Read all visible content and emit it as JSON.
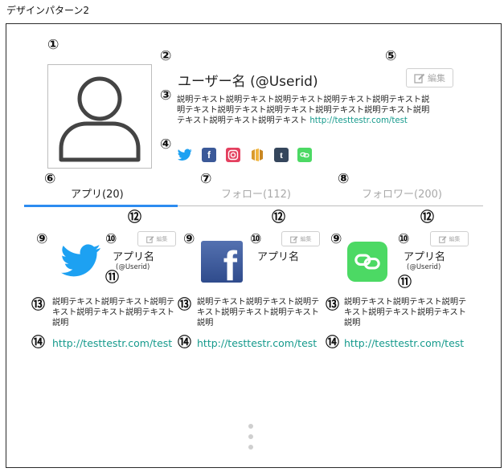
{
  "page_title": "デザインパターン2",
  "markers": [
    "①",
    "②",
    "③",
    "④",
    "⑤",
    "⑥",
    "⑦",
    "⑧",
    "⑨",
    "⑩",
    "⑪",
    "⑫",
    "⑬",
    "⑭"
  ],
  "profile": {
    "username": "ユーザー名 (@Userid)",
    "edit_label": "編集",
    "description": "説明テキスト説明テキスト説明テキスト説明テキスト説明テキスト説明テキスト説明テキスト説明テキスト説明テキスト説明テキスト説明テキスト説明テキスト説明テキスト ",
    "link": "http://testtestr.com/test",
    "social_icons": [
      "twitter-icon",
      "facebook-icon",
      "instagram-icon",
      "aws-icon",
      "tumblr-icon",
      "line-icon"
    ]
  },
  "tabs": [
    {
      "label": "アプリ(20)",
      "active": true
    },
    {
      "label": "フォロー(112)",
      "active": false
    },
    {
      "label": "フォロワー(200)",
      "active": false
    }
  ],
  "apps": [
    {
      "icon": "twitter-icon",
      "name": "アプリ名",
      "userid": "(@Userid)",
      "edit_label": "編集",
      "description": "説明テキスト説明テキスト説明テキスト説明テキスト説明テキスト説明",
      "link": "http://testtestr.com/test"
    },
    {
      "icon": "facebook-icon",
      "name": "アプリ名",
      "userid": "",
      "edit_label": "編集",
      "description": "説明テキスト説明テキスト説明テキスト説明テキスト説明テキスト説明",
      "link": "http://testtestr.com/test"
    },
    {
      "icon": "line-icon",
      "name": "アプリ名",
      "userid": "(@Userid)",
      "edit_label": "編集",
      "description": "説明テキスト説明テキスト説明テキスト説明テキスト説明テキスト説明",
      "link": "http://testtestr.com/test"
    }
  ],
  "colors": {
    "accent": "#2d8cf0",
    "link": "#159a8c",
    "twitter": "#1da1f2",
    "facebook": "#3b5998",
    "line": "#4cd964"
  }
}
